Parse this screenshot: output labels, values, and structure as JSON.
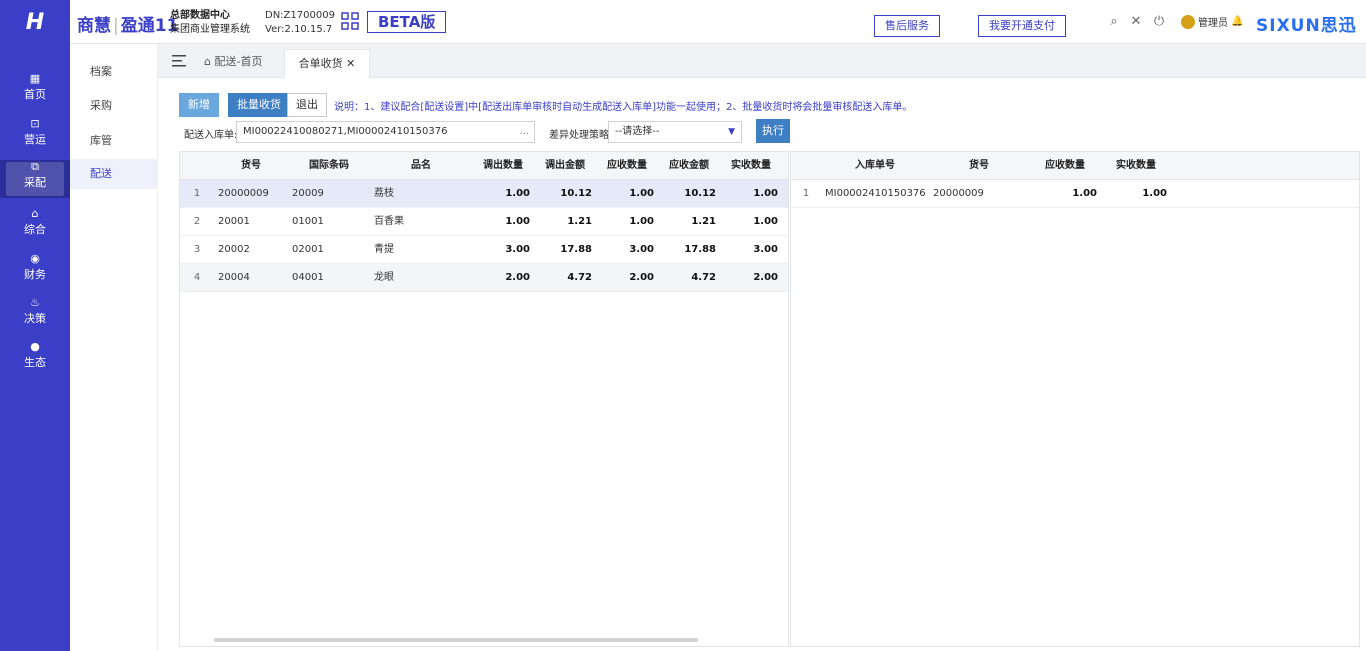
{
  "header": {
    "logo_text": "H",
    "brand_left": "商慧",
    "brand_right": "盈通11",
    "org_line1": "总部数据中心",
    "org_line2": "集团商业管理系统",
    "dn_line1": "DN:Z1700009",
    "dn_line2": "Ver:2.10.15.7",
    "beta_label": "BETA版",
    "after_sales_label": "售后服务",
    "payment_label": "我要开通支付",
    "user_label": "管理员",
    "company_logo": "SIXUN思迅"
  },
  "sidebar": {
    "items": [
      {
        "icon": "▦",
        "label": "首页"
      },
      {
        "icon": "⊡",
        "label": "营运"
      },
      {
        "icon": "⧉",
        "label": "采配"
      },
      {
        "icon": "⌂",
        "label": "综合"
      },
      {
        "icon": "◉",
        "label": "财务"
      },
      {
        "icon": "♨",
        "label": "决策"
      },
      {
        "icon": "●",
        "label": "生态"
      }
    ]
  },
  "submenu": {
    "items": [
      "档案",
      "采购",
      "库管",
      "配送"
    ]
  },
  "tabs": {
    "home_label": "配送-首页",
    "active_label": "合单收货 ✕"
  },
  "toolbar": {
    "new_label": "新增",
    "batch_receive_label": "批量收货",
    "exit_label": "退出",
    "note": "说明：1、建议配合[配送设置]中[配送出库单审核时自动生成配送入库单]功能一起使用；2、批量收货时将会批量审核配送入库单。",
    "inbound_label": "配送入库单:",
    "inbound_value": "MI00022410080271,MI00002410150376",
    "strategy_label": "差异处理策略:",
    "strategy_value": "--请选择--",
    "execute_label": "执行"
  },
  "left_grid": {
    "columns": [
      "",
      "货号",
      "国际条码",
      "品名",
      "调出数量",
      "调出金额",
      "应收数量",
      "应收金额",
      "实收数量"
    ],
    "rows": [
      [
        "1",
        "20000009",
        "20009",
        "荔枝",
        "1.00",
        "10.12",
        "1.00",
        "10.12",
        "1.00"
      ],
      [
        "2",
        "20001",
        "01001",
        "百香果",
        "1.00",
        "1.21",
        "1.00",
        "1.21",
        "1.00"
      ],
      [
        "3",
        "20002",
        "02001",
        "青提",
        "3.00",
        "17.88",
        "3.00",
        "17.88",
        "3.00"
      ],
      [
        "4",
        "20004",
        "04001",
        "龙眼",
        "2.00",
        "4.72",
        "2.00",
        "4.72",
        "2.00"
      ]
    ]
  },
  "right_grid": {
    "columns": [
      "",
      "入库单号",
      "货号",
      "应收数量",
      "实收数量"
    ],
    "rows": [
      [
        "1",
        "MI00002410150376",
        "20000009",
        "1.00",
        "1.00"
      ]
    ]
  },
  "colors": {
    "primary": "#3b3fc8",
    "button_blue": "#3e7fc4",
    "button_light": "#6aa7dc",
    "brand_sixun": "#2a6ff0"
  }
}
